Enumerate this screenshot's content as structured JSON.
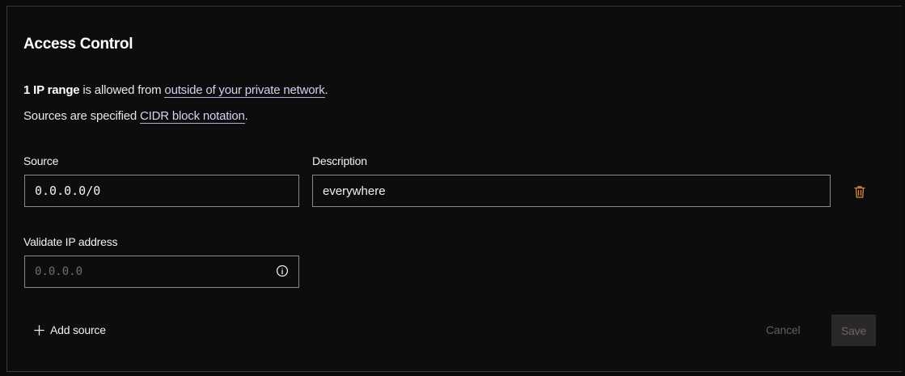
{
  "section": {
    "title": "Access Control",
    "summary_count": "1 IP range",
    "summary_middle": " is allowed from ",
    "summary_link": "outside of your private network",
    "summary_end": ".",
    "notation_prefix": "Sources are specified ",
    "notation_link": "CIDR block notation",
    "notation_end": "."
  },
  "form": {
    "source_label": "Source",
    "source_value": "0.0.0.0/0",
    "description_label": "Description",
    "description_value": "everywhere",
    "validate_label": "Validate IP address",
    "validate_placeholder": "0.0.0.0"
  },
  "actions": {
    "add_source": "Add source",
    "cancel": "Cancel",
    "save": "Save"
  },
  "colors": {
    "background": "#0d0d0e",
    "border": "#8a8a8c",
    "link": "#d7d0ef",
    "trash_icon": "#d98a3a",
    "disabled_text": "#5f5f63",
    "save_bg": "#2b2828"
  },
  "icons": {
    "delete": "trash-icon",
    "info": "info-icon",
    "add": "plus-icon"
  }
}
